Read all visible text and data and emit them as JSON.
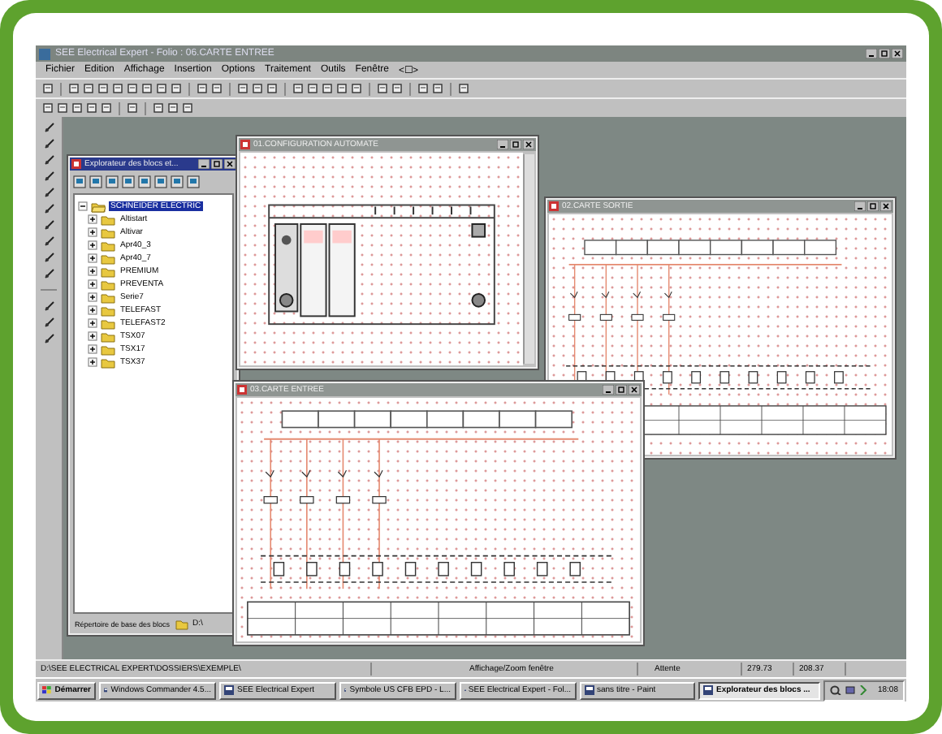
{
  "window": {
    "title": "SEE Electrical Expert - Folio : 06.CARTE ENTREE"
  },
  "menu": [
    "Fichier",
    "Edition",
    "Affichage",
    "Insertion",
    "Options",
    "Traitement",
    "Outils",
    "Fenêtre",
    "<☐>"
  ],
  "documents": [
    {
      "title": "01.CONFIGURATION AUTOMATE",
      "kind": "rack"
    },
    {
      "title": "02.CARTE SORTIE",
      "kind": "card"
    },
    {
      "title": "03.CARTE ENTREE",
      "kind": "card"
    }
  ],
  "explorer": {
    "title": "Explorateur des blocs et...",
    "tree": [
      {
        "label": "SCHNEIDER ELECTRIC",
        "selected": true,
        "expanded": true,
        "children": [
          {
            "label": "Altistart",
            "selected": false,
            "expanded": false
          },
          {
            "label": "Altivar",
            "selected": false,
            "expanded": false
          },
          {
            "label": "Apr40_3",
            "selected": false,
            "expanded": false
          },
          {
            "label": "Apr40_7",
            "selected": false,
            "expanded": false
          },
          {
            "label": "PREMIUM",
            "selected": false,
            "expanded": false
          },
          {
            "label": "PREVENTA",
            "selected": false,
            "expanded": false
          },
          {
            "label": "Serie7",
            "selected": false,
            "expanded": false
          },
          {
            "label": "TELEFAST",
            "selected": false,
            "expanded": false
          },
          {
            "label": "TELEFAST2",
            "selected": false,
            "expanded": false
          },
          {
            "label": "TSX07",
            "selected": false,
            "expanded": false
          },
          {
            "label": "TSX17",
            "selected": false,
            "expanded": false
          },
          {
            "label": "TSX37",
            "selected": false,
            "expanded": false
          }
        ]
      }
    ],
    "footer_label": "Répertoire de base des blocs",
    "footer_drive": "D:\\"
  },
  "status_bar": [
    "D:\\SEE ELECTRICAL EXPERT\\DOSSIERS\\EXEMPLE\\",
    "Affichage/Zoom fenêtre",
    "Attente",
    "279.73",
    "208.37"
  ],
  "taskbar": {
    "start": "Démarrer",
    "tasks": [
      {
        "label": "Windows Commander 4.5...",
        "selected": false
      },
      {
        "label": "SEE Electrical Expert",
        "selected": false
      },
      {
        "label": "Symbole US CFB EPD - L...",
        "selected": false
      },
      {
        "label": "SEE Electrical Expert - Fol...",
        "selected": false
      },
      {
        "label": "sans titre - Paint",
        "selected": false
      },
      {
        "label": "Explorateur des blocs ...",
        "selected": true
      }
    ],
    "clock": "18:08"
  }
}
